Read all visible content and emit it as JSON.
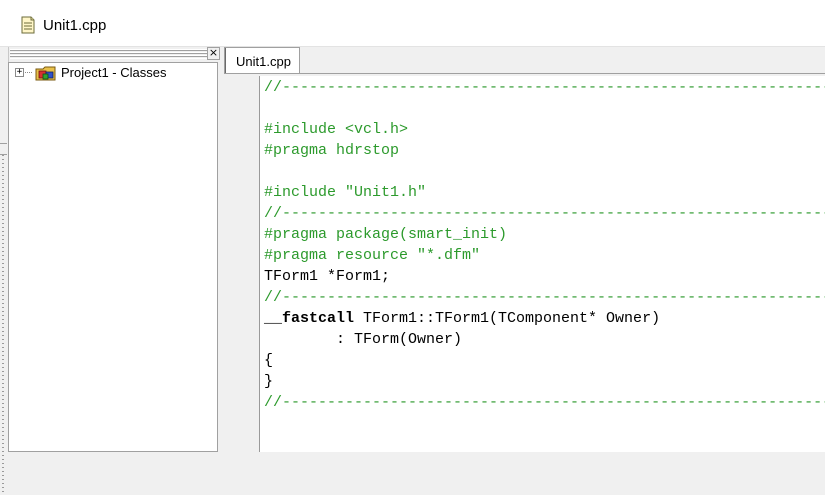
{
  "window": {
    "title": "Unit1.cpp"
  },
  "explorer": {
    "close_label": "×",
    "tree_expand": "+",
    "root_label": "Project1 - Classes"
  },
  "editor": {
    "tab_label": "Unit1.cpp",
    "lines": {
      "l0": "//---------------------------------------------------------------------------",
      "l2": "#include <vcl.h>",
      "l3": "#pragma hdrstop",
      "l5": "#include \"Unit1.h\"",
      "l6": "//---------------------------------------------------------------------------",
      "l7": "#pragma package(smart_init)",
      "l8": "#pragma resource \"*.dfm\"",
      "l9": "TForm1 *Form1;",
      "l10": "//---------------------------------------------------------------------------",
      "l11_kw": "__fastcall",
      "l11_rest": " TForm1::TForm1(TComponent* Owner)",
      "l12": "        : TForm(Owner)",
      "l13": "{",
      "l14": "}",
      "l15": "//---------------------------------------------------------------------------"
    }
  },
  "colors": {
    "comment": "#2c9a2c",
    "preprocessor": "#2c9a2c",
    "text": "#000000"
  }
}
